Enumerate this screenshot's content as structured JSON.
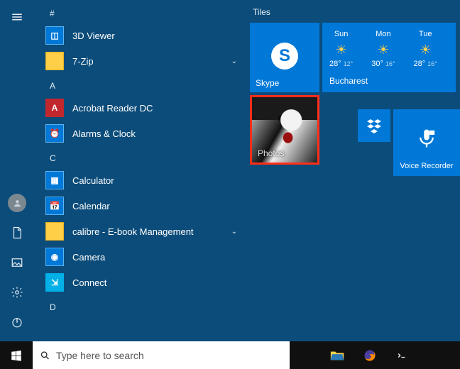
{
  "rail": {
    "hamburger": "menu",
    "user": "user-account",
    "documents": "documents",
    "pictures": "pictures",
    "settings": "settings",
    "power": "power"
  },
  "appList": {
    "sections": [
      {
        "letter": "#",
        "items": [
          {
            "label": "3D Viewer",
            "iconClass": "ico-blue",
            "glyph": "◫"
          },
          {
            "label": "7-Zip",
            "iconClass": "ico-folder",
            "glyph": "",
            "expandable": true
          }
        ]
      },
      {
        "letter": "A",
        "items": [
          {
            "label": "Acrobat Reader DC",
            "iconClass": "ico-red",
            "glyph": "A"
          },
          {
            "label": "Alarms & Clock",
            "iconClass": "ico-blue",
            "glyph": "⏰"
          }
        ]
      },
      {
        "letter": "C",
        "items": [
          {
            "label": "Calculator",
            "iconClass": "ico-blue",
            "glyph": "▦"
          },
          {
            "label": "Calendar",
            "iconClass": "ico-blue",
            "glyph": "📅"
          },
          {
            "label": "calibre - E-book Management",
            "iconClass": "ico-folder",
            "glyph": "",
            "expandable": true
          },
          {
            "label": "Camera",
            "iconClass": "ico-blue",
            "glyph": "◉"
          },
          {
            "label": "Connect",
            "iconClass": "ico-cyan",
            "glyph": "⇲"
          }
        ]
      },
      {
        "letter": "D",
        "items": []
      }
    ]
  },
  "tiles": {
    "header": "Tiles",
    "skype": {
      "label": "Skype"
    },
    "weather": {
      "city": "Bucharest",
      "days": [
        {
          "name": "Sun",
          "hi": "28°",
          "lo": "12°"
        },
        {
          "name": "Mon",
          "hi": "30°",
          "lo": "16°"
        },
        {
          "name": "Tue",
          "hi": "28°",
          "lo": "16°"
        }
      ]
    },
    "photos": {
      "label": "Photos"
    },
    "voice": {
      "label": "Voice Recorder"
    }
  },
  "taskbar": {
    "searchPlaceholder": "Type here to search"
  }
}
